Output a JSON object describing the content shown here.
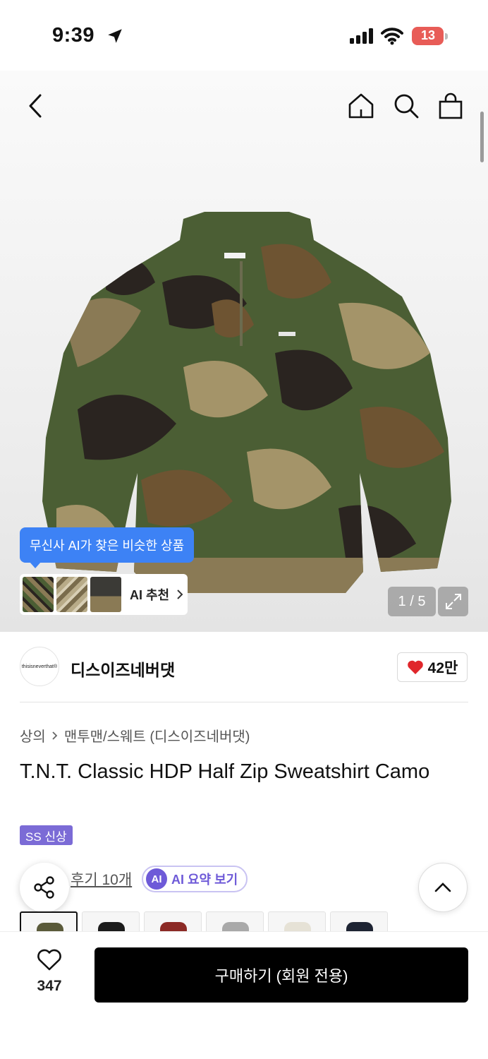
{
  "status_bar": {
    "time": "9:39",
    "battery": "13"
  },
  "hero": {
    "ai_tooltip": "무신사 AI가 찾은 비슷한 상품",
    "ai_recommend_label": "AI 추천",
    "image_counter": "1 / 5"
  },
  "brand": {
    "logo_text": "thisisneverthat®",
    "name": "디스이즈네버댓",
    "likes": "42만"
  },
  "product": {
    "breadcrumb": [
      "상의",
      "맨투맨/스웨트 (디스이즈네버댓)"
    ],
    "title": "T.N.T. Classic HDP Half Zip Sweatshirt Camo",
    "badge": "SS 신상",
    "review_link": "후기 10개",
    "ai_summary_chip": "AI",
    "ai_summary_label": "AI 요약 보기"
  },
  "colors": {
    "accent_blue": "#3d82f5",
    "badge_purple": "#7b6bd6",
    "heart_red": "#e0262b"
  },
  "bottom_bar": {
    "wish_count": "347",
    "buy_label": "구매하기 (회원 전용)"
  }
}
